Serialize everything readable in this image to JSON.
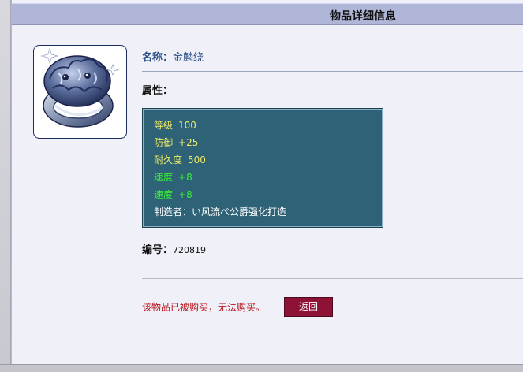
{
  "header": {
    "title": "物品详细信息"
  },
  "item": {
    "icon": "silver-ring-icon",
    "name_label": "名称：",
    "name_value": "金麟绕",
    "attributes_label": "属性：",
    "attributes": [
      {
        "name": "等级",
        "value": "100",
        "color": "#f0ea64"
      },
      {
        "name": "防御",
        "value": "+25",
        "color": "#f0ea64"
      },
      {
        "name": "耐久度",
        "value": "500",
        "color": "#f0ea64"
      },
      {
        "name": "速度",
        "value": "+8",
        "color": "#38ee38"
      },
      {
        "name": "速度",
        "value": "+8",
        "color": "#38ee38"
      }
    ],
    "maker_line": "制造者：い风流ぺ公爵强化打造",
    "code_label": "编号：",
    "code_value": "720819"
  },
  "footer": {
    "status_message": "该物品已被购买，无法购买。",
    "back_button_label": "返回"
  },
  "colors": {
    "title_bar": "#b0b6d8",
    "panel_background": "#f0f0f8",
    "attribute_box": "#2e6276",
    "status_message": "#b8141c",
    "back_button": "#8e1236"
  }
}
